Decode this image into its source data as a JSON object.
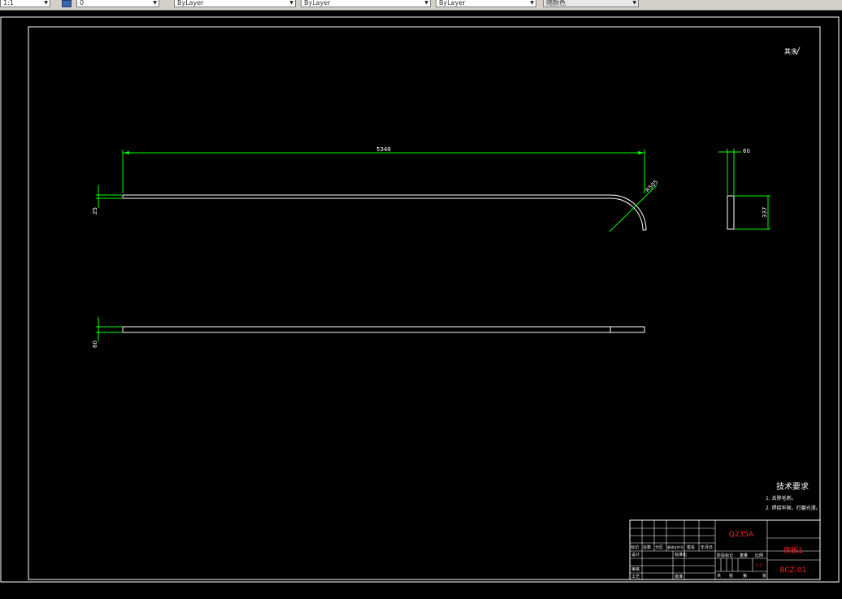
{
  "toolbar": {
    "combos": [
      {
        "name": "scale-combo",
        "value": "1:1"
      },
      {
        "name": "layer-combo",
        "value": "0"
      },
      {
        "name": "color-combo",
        "value": "ByLayer"
      },
      {
        "name": "linetype-combo",
        "value": "ByLayer"
      },
      {
        "name": "lineweight-combo",
        "value": "ByLayer"
      },
      {
        "name": "plotstyle-combo",
        "value": "随颜色"
      }
    ]
  },
  "drawing": {
    "roughness_note": "其余",
    "dimensions": {
      "length": "5348",
      "radius": "R505",
      "thickness_top": "25",
      "width_side": "60",
      "height_side": "337",
      "thickness_bottom": "60"
    },
    "tech_requirements": {
      "title": "技术要求",
      "items": [
        "1. 去除毛刺。",
        "2. 焊接牢固，打磨光滑。"
      ]
    },
    "title_block": {
      "material": "Q235A",
      "part_name": "侧板1",
      "drawing_number": "BCZ-01",
      "row_labels": [
        "设计",
        "审核",
        "工艺"
      ],
      "col_header": [
        "标记",
        "处数",
        "分区",
        "更改文件号",
        "签名",
        "年月日"
      ],
      "mid_labels": [
        "标准化",
        "批准"
      ],
      "stage_header": [
        "阶段标记",
        "重量",
        "比例"
      ],
      "scale_value": "1:1",
      "sheet_text": [
        "共",
        "张",
        "第",
        "张"
      ]
    }
  },
  "colors": {
    "background": "#000000",
    "geometry": "#ffffff",
    "dimension": "#00ff00",
    "title_text": "#ff2020",
    "dim_text": "#ffffff"
  }
}
